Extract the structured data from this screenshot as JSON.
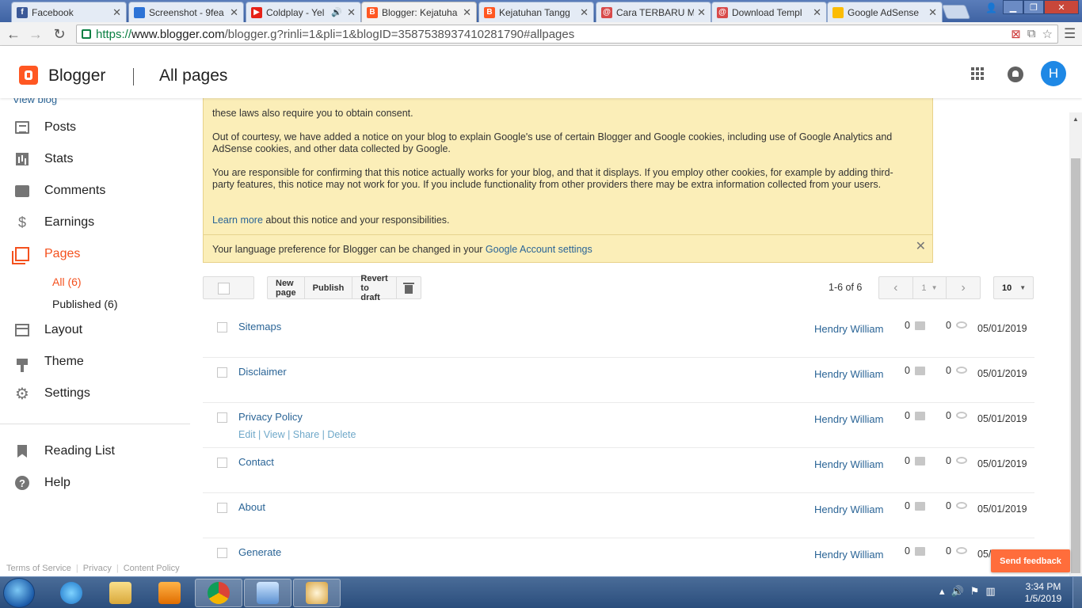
{
  "browser": {
    "tabs": [
      {
        "title": "Facebook",
        "favicon": "facebook-icon",
        "color": "#3b5998",
        "glyph": "f"
      },
      {
        "title": "Screenshot - 9fea",
        "favicon": "screenshot-icon",
        "color": "#2d73d6",
        "glyph": ""
      },
      {
        "title": "Coldplay - Yel",
        "favicon": "youtube-icon",
        "color": "#e62117",
        "glyph": "▶"
      },
      {
        "title": "Blogger: Kejatuha",
        "favicon": "blogger-icon",
        "color": "#ff5722",
        "glyph": "B"
      },
      {
        "title": "Kejatuhan Tangg",
        "favicon": "blogger-icon",
        "color": "#ff5722",
        "glyph": "B"
      },
      {
        "title": "Cara TERBARU M",
        "favicon": "site-icon",
        "color": "#d84a4a",
        "glyph": "@"
      },
      {
        "title": "Download Templ",
        "favicon": "site-icon",
        "color": "#d84a4a",
        "glyph": "@"
      },
      {
        "title": "Google AdSense",
        "favicon": "adsense-icon",
        "color": "#fbbc04",
        "glyph": ""
      }
    ],
    "active_tab_index": 3,
    "url_secure": "https://",
    "url_host": "www.blogger.com",
    "url_path": "/blogger.g?rinli=1&pli=1&blogID=3587538937410281790#allpages"
  },
  "header": {
    "brand": "Blogger",
    "page_title": "All pages",
    "avatar_letter": "H"
  },
  "sidebar": {
    "view_blog": "View blog",
    "items": [
      {
        "label": "Posts",
        "icon": "posts-icon"
      },
      {
        "label": "Stats",
        "icon": "stats-icon"
      },
      {
        "label": "Comments",
        "icon": "comments-icon"
      },
      {
        "label": "Earnings",
        "icon": "earnings-icon"
      },
      {
        "label": "Pages",
        "icon": "pages-icon"
      },
      {
        "label": "Layout",
        "icon": "layout-icon"
      },
      {
        "label": "Theme",
        "icon": "theme-icon"
      },
      {
        "label": "Settings",
        "icon": "settings-icon"
      }
    ],
    "active_item": "Pages",
    "sub_items": [
      {
        "label": "All (6)"
      },
      {
        "label": "Published (6)"
      }
    ],
    "secondary": [
      {
        "label": "Reading List",
        "icon": "bookmark-icon"
      },
      {
        "label": "Help",
        "icon": "help-icon"
      }
    ],
    "footer": {
      "terms": "Terms of Service",
      "privacy": "Privacy",
      "content_policy": "Content Policy"
    }
  },
  "notice": {
    "top_fragment": "these laws also require you to obtain consent.",
    "courtesy": "Out of courtesy, we have added a notice on your blog to explain Google's use of certain Blogger and Google cookies, including use of Google Analytics and AdSense cookies, and other data collected by Google.",
    "responsible": "You are responsible for confirming that this notice actually works for your blog, and that it displays. If you employ other cookies, for example by adding third-party features, this notice may not work for you. If you include functionality from other providers there may be extra information collected from your users.",
    "learn_more": "Learn more",
    "learn_more_rest": " about this notice and your responsibilities.",
    "language_text": "Your language preference for Blogger can be changed in your ",
    "language_link": "Google Account settings"
  },
  "actions": {
    "new_page": "New page",
    "publish": "Publish",
    "revert": "Revert to draft"
  },
  "pagination": {
    "count": "1-6 of 6",
    "page": "1",
    "per_page": "10"
  },
  "pages": [
    {
      "title": "Sitemaps",
      "author": "Hendry William",
      "comments": "0",
      "views": "0",
      "date": "05/01/2019",
      "row_actions": ""
    },
    {
      "title": "Disclaimer",
      "author": "Hendry William",
      "comments": "0",
      "views": "0",
      "date": "05/01/2019",
      "row_actions": ""
    },
    {
      "title": "Privacy Policy",
      "author": "Hendry William",
      "comments": "0",
      "views": "0",
      "date": "05/01/2019",
      "row_actions": "Edit | View | Share | Delete"
    },
    {
      "title": "Contact",
      "author": "Hendry William",
      "comments": "0",
      "views": "0",
      "date": "05/01/2019",
      "row_actions": ""
    },
    {
      "title": "About",
      "author": "Hendry William",
      "comments": "0",
      "views": "0",
      "date": "05/01/2019",
      "row_actions": ""
    },
    {
      "title": "Generate",
      "author": "Hendry William",
      "comments": "0",
      "views": "0",
      "date": "05/0",
      "row_actions": ""
    }
  ],
  "feedback": "Send feedback",
  "taskbar": {
    "time": "3:34 PM",
    "date": "1/5/2019"
  },
  "colors": {
    "accent": "#f4511e",
    "link": "#2a6496",
    "notice_bg": "#fbeeb8"
  }
}
